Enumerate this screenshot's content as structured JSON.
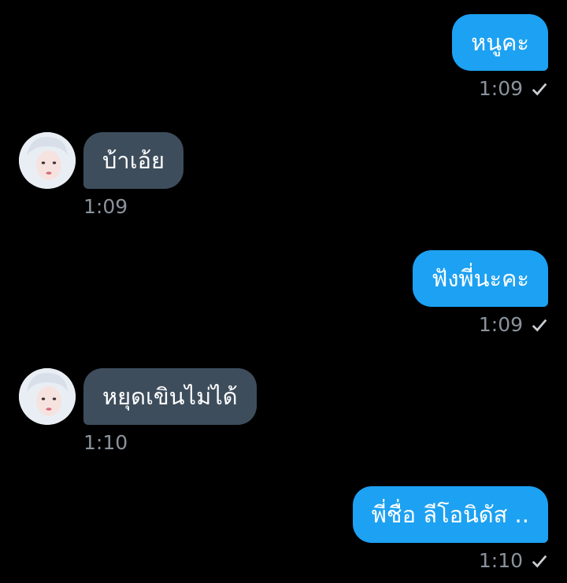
{
  "messages": [
    {
      "direction": "outgoing",
      "text": "หนูคะ",
      "time": "1:09",
      "status_icon": "check-icon"
    },
    {
      "direction": "incoming",
      "text": "บ้าเอ้ย",
      "time": "1:09",
      "avatar_icon": "avatar"
    },
    {
      "direction": "outgoing",
      "text": "ฟังพี่นะคะ",
      "time": "1:09",
      "status_icon": "check-icon"
    },
    {
      "direction": "incoming",
      "text": "หยุดเขินไม่ได้",
      "time": "1:10",
      "avatar_icon": "avatar"
    },
    {
      "direction": "outgoing",
      "text": "พี่ชื่อ ลีโอนิดัส ..",
      "time": "1:10",
      "status_icon": "check-icon"
    }
  ],
  "colors": {
    "background": "#000000",
    "outgoing_bubble": "#1da1f2",
    "incoming_bubble": "#3d4d5c",
    "timestamp": "#8a939c"
  }
}
